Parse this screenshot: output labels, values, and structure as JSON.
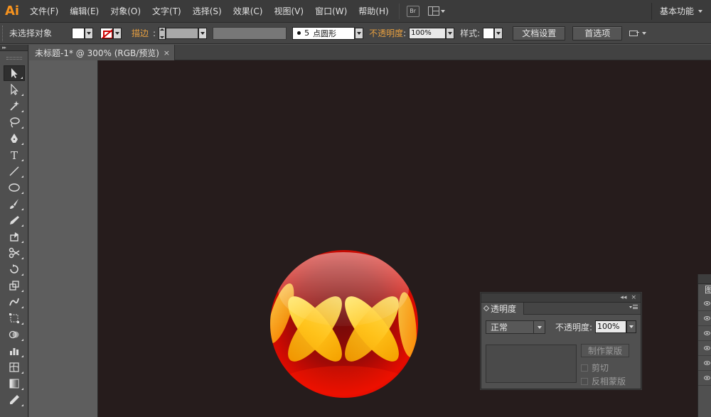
{
  "app": {
    "logo": "Ai",
    "menus": [
      "文件(F)",
      "编辑(E)",
      "对象(O)",
      "文字(T)",
      "选择(S)",
      "效果(C)",
      "视图(V)",
      "窗口(W)",
      "帮助(H)"
    ],
    "bridge_label": "Br",
    "workspace": "基本功能"
  },
  "control_bar": {
    "selection_status": "未选择对象",
    "stroke_label": "描边",
    "brush_size": "5",
    "brush_label": "点圆形",
    "opacity_label": "不透明度",
    "opacity_value": "100%",
    "style_label": "样式",
    "doc_setup_button": "文档设置",
    "prefs_button": "首选项"
  },
  "tool_panel": {
    "header": "▸▸",
    "tools": [
      {
        "name": "selection-tool-icon",
        "active": true
      },
      {
        "name": "direct-selection-tool-icon"
      },
      {
        "name": "magic-wand-tool-icon"
      },
      {
        "name": "lasso-tool-icon"
      },
      {
        "name": "pen-tool-icon"
      },
      {
        "name": "type-tool-icon",
        "glyph": "T"
      },
      {
        "name": "line-segment-tool-icon"
      },
      {
        "name": "ellipse-tool-icon"
      },
      {
        "name": "paintbrush-tool-icon"
      },
      {
        "name": "pencil-tool-icon"
      },
      {
        "name": "blob-brush-tool-icon"
      },
      {
        "name": "scissors-tool-icon"
      },
      {
        "name": "rotate-tool-icon"
      },
      {
        "name": "scale-tool-icon"
      },
      {
        "name": "warp-tool-icon"
      },
      {
        "name": "free-transform-tool-icon"
      },
      {
        "name": "shape-builder-tool-icon"
      },
      {
        "name": "graph-tool-icon"
      },
      {
        "name": "mesh-tool-icon"
      },
      {
        "name": "gradient-tool-icon"
      },
      {
        "name": "eyedropper-tool-icon"
      }
    ]
  },
  "document": {
    "tab_title": "未标题-1* @ 300% (RGB/预览)",
    "close_glyph": "×"
  },
  "transparency_panel": {
    "collapse_glyph": "◂◂",
    "close_glyph": "×",
    "tab_label": "透明度",
    "blend_mode": "正常",
    "opacity_label": "不透明度:",
    "opacity_value": "100%",
    "make_mask_button": "制作蒙版",
    "clip_label": "剪切",
    "invert_mask_label": "反相蒙版"
  },
  "layers_panel": {
    "tab_label": "图层"
  },
  "colors": {
    "accent_orange": "#f7931e",
    "artboard_bg": "#261c1c",
    "sphere_red": "#d40000",
    "petal_yellow": "#ffd23a"
  }
}
